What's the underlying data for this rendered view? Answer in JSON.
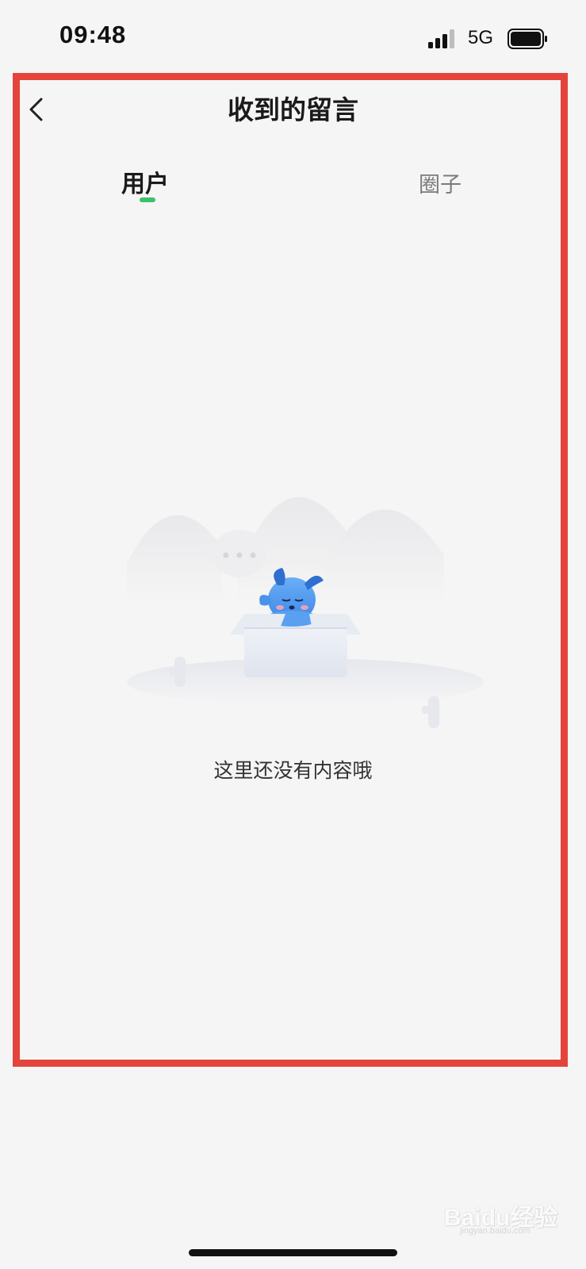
{
  "status_bar": {
    "time": "09:48",
    "network": "5G",
    "signal_icon": "signal-bars-icon",
    "battery_icon": "battery-icon"
  },
  "nav": {
    "back_icon": "chevron-left-icon",
    "title": "收到的留言"
  },
  "tabs": [
    {
      "label": "用户",
      "active": true
    },
    {
      "label": "圈子",
      "active": false
    }
  ],
  "empty_state": {
    "message": "这里还没有内容哦",
    "illustration": "empty-box-mascot-illustration"
  },
  "watermark": {
    "text": "Baidu经验",
    "sub": "jingyan.baidu.com"
  },
  "colors": {
    "accent": "#3cc26b",
    "annotation": "#e4443b",
    "background": "#f5f5f5"
  }
}
